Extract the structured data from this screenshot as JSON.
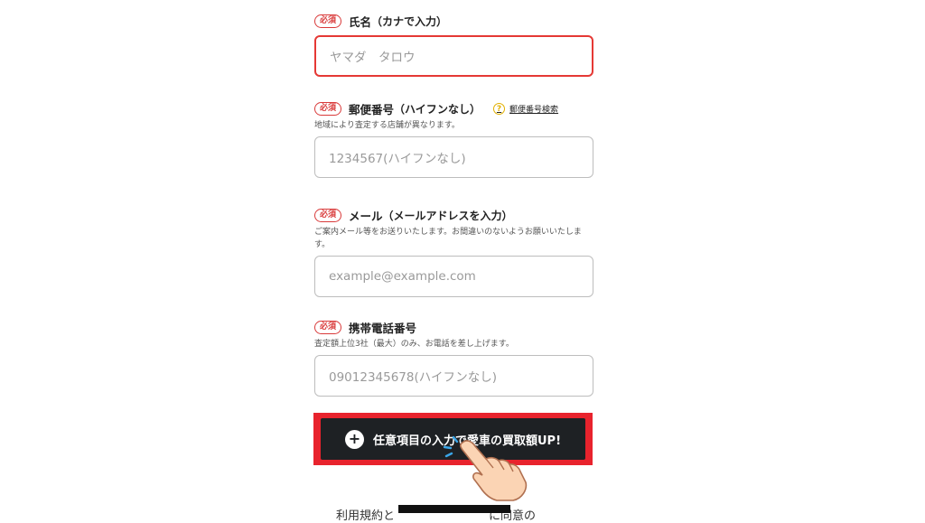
{
  "required_badge": "必須",
  "name": {
    "label": "氏名",
    "sublabel": "（カナで入力）",
    "placeholder": "ヤマダ　タロウ"
  },
  "postal": {
    "label": "郵便番号",
    "sublabel": "（ハイフンなし）",
    "help_link": "郵便番号検索",
    "note": "地域により査定する店舗が異なります。",
    "placeholder": "1234567(ハイフンなし)"
  },
  "email": {
    "label": "メール",
    "sublabel": "（メールアドレスを入力）",
    "note": "ご案内メール等をお送りいたします。お間違いのないようお願いいたします。",
    "placeholder": "example@example.com"
  },
  "phone": {
    "label": "携帯電話番号",
    "note": "査定額上位3社（最大）のみ、お電話を差し上げます。",
    "placeholder": "09012345678(ハイフンなし)"
  },
  "cta": {
    "label": "任意項目の入力で愛車の買取額UP!",
    "icon": "plus-icon"
  },
  "footer": {
    "text": "利用規約と　　　　　　　　に同意の"
  },
  "colors": {
    "required": "#d93a3a",
    "error_border": "#e53935",
    "cta_frame": "#e8232d",
    "cta_bg": "#1e2124"
  }
}
